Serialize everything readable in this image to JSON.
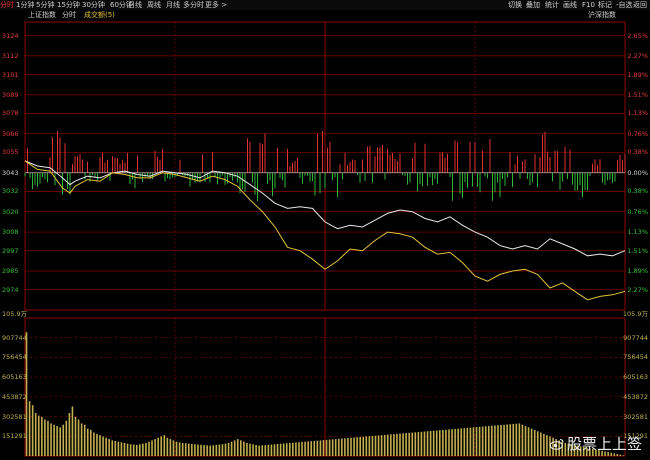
{
  "toolbar": {
    "periods": [
      {
        "label": "分时",
        "active": true
      },
      {
        "label": "1分钟",
        "active": false
      },
      {
        "label": "5分钟",
        "active": false
      },
      {
        "label": "15分钟",
        "active": false
      },
      {
        "label": "30分钟",
        "active": false
      },
      {
        "label": "60分钟",
        "active": false
      },
      {
        "label": "日线",
        "active": false
      },
      {
        "label": "周线",
        "active": false
      },
      {
        "label": "月线",
        "active": false
      },
      {
        "label": "多分时",
        "active": false
      },
      {
        "label": "更多 >",
        "active": false
      }
    ],
    "actions": [
      "切换",
      "叠加",
      "统计",
      "画线",
      "F10",
      "标记",
      "-自选",
      "返回"
    ]
  },
  "chart_header": {
    "index_name": "上证指数",
    "mode_label": "分时",
    "indicator_label": "成交额(5)",
    "compare_label": "沪深指数"
  },
  "colors": {
    "up": "#e03232",
    "down": "#2fb33a",
    "line_white": "#e8e8e8",
    "line_yellow": "#e0c23a",
    "grid": "#8b0000",
    "red_text": "#e03c3c",
    "green_text": "#38c038",
    "volume": "#c0b050"
  },
  "chart_data": [
    {
      "type": "line",
      "y_labels_left": [
        "3124",
        "3112",
        "3101",
        "3089",
        "3078",
        "3066",
        "3055",
        "3043",
        "3032",
        "3020",
        "3008",
        "2997",
        "2985",
        "2974"
      ],
      "y_labels_right": [
        "2.65%",
        "2.27%",
        "1.89%",
        "1.51%",
        "1.13%",
        "0.76%",
        "0.38%",
        "0.00%",
        "0.38%",
        "0.76%",
        "1.13%",
        "1.51%",
        "1.89%",
        "2.27%"
      ],
      "ylim": [
        2962,
        3132
      ],
      "baseline": 3043,
      "x_minutes": [
        0,
        5,
        10,
        15,
        18,
        20,
        25,
        30,
        35,
        40,
        45,
        50,
        55,
        60,
        65,
        70,
        75,
        80,
        85,
        90,
        95,
        100,
        105,
        110,
        115,
        120,
        125,
        130,
        135,
        140,
        145,
        150,
        155,
        160,
        165,
        170,
        175,
        180,
        185,
        190,
        195,
        200,
        205,
        210,
        215,
        220,
        225,
        230,
        235,
        240
      ],
      "series": [
        {
          "values": [
            3050,
            3047,
            3046,
            3040,
            3036,
            3038,
            3041,
            3040,
            3043,
            3044,
            3042,
            3041,
            3044,
            3043,
            3042,
            3040,
            3044,
            3043,
            3041,
            3036,
            3031,
            3025,
            3022,
            3023,
            3022,
            3014,
            3010,
            3012,
            3011,
            3015,
            3019,
            3021,
            3020,
            3016,
            3014,
            3017,
            3012,
            3008,
            3005,
            3000,
            2998,
            3000,
            2998,
            3004,
            3001,
            2998,
            2994,
            2995,
            2994,
            2997
          ]
        },
        {
          "values": [
            3050,
            3045,
            3044,
            3034,
            3031,
            3035,
            3039,
            3038,
            3043,
            3042,
            3040,
            3040,
            3043,
            3042,
            3040,
            3038,
            3041,
            3039,
            3035,
            3027,
            3020,
            3011,
            2999,
            2997,
            2992,
            2986,
            2991,
            2998,
            2997,
            3003,
            3008,
            3007,
            3005,
            2999,
            2995,
            2996,
            2990,
            2982,
            2979,
            2983,
            2985,
            2986,
            2983,
            2975,
            2978,
            2973,
            2968,
            2970,
            2971,
            2973
          ]
        }
      ]
    },
    {
      "type": "bar",
      "ylabel_unit": "105.9万",
      "y_labels": [
        "907744",
        "756454",
        "605163",
        "453872",
        "302581",
        "151291"
      ],
      "ylim": [
        0,
        1059000
      ],
      "values": [
        950000,
        420000,
        390000,
        330000,
        310000,
        300000,
        280000,
        270000,
        250000,
        240000,
        230000,
        220000,
        240000,
        270000,
        330000,
        380000,
        300000,
        280000,
        250000,
        240000,
        210000,
        200000,
        180000,
        170000,
        160000,
        150000,
        140000,
        130000,
        120000,
        115000,
        110000,
        105000,
        100000,
        95000,
        90000,
        88000,
        85000,
        90000,
        95000,
        100000,
        110000,
        120000,
        130000,
        140000,
        150000,
        160000,
        140000,
        130000,
        120000,
        110000,
        105000,
        100000,
        98000,
        95000,
        92000,
        90000,
        88000,
        86000,
        84000,
        82000,
        80000,
        82000,
        85000,
        88000,
        90000,
        95000,
        100000,
        110000,
        120000,
        130000,
        120000,
        110000,
        100000,
        95000,
        90000,
        85000,
        80000,
        82000,
        84000,
        86000,
        88000,
        90000,
        92000,
        94000,
        96000,
        98000,
        100000,
        102000,
        104000,
        106000,
        108000,
        110000,
        112000,
        114000,
        116000,
        118000,
        120000,
        122000,
        124000,
        126000,
        128000,
        130000,
        132000,
        134000,
        136000,
        138000,
        140000,
        142000,
        144000,
        146000,
        148000,
        150000,
        152000,
        154000,
        156000,
        158000,
        160000,
        162000,
        164000,
        166000,
        168000,
        170000,
        172000,
        174000,
        176000,
        178000,
        180000,
        182000,
        184000,
        186000,
        188000,
        190000,
        192000,
        194000,
        196000,
        198000,
        200000,
        202000,
        204000,
        206000,
        208000,
        210000,
        212000,
        214000,
        216000,
        218000,
        220000,
        222000,
        224000,
        226000,
        228000,
        230000,
        232000,
        234000,
        236000,
        238000,
        240000,
        242000,
        244000,
        246000,
        248000,
        250000,
        240000,
        230000,
        220000,
        210000,
        200000,
        190000,
        180000,
        170000,
        160000,
        150000,
        140000,
        130000,
        120000,
        110000,
        100000,
        95000,
        90000,
        85000,
        80000,
        75000,
        70000,
        65000,
        60000,
        55000,
        50000,
        45000,
        40000,
        35000,
        30000,
        25000,
        20000,
        15000,
        10000,
        5000
      ]
    }
  ],
  "watermark": {
    "text": "股票上上签",
    "icon": "weibo-icon"
  }
}
